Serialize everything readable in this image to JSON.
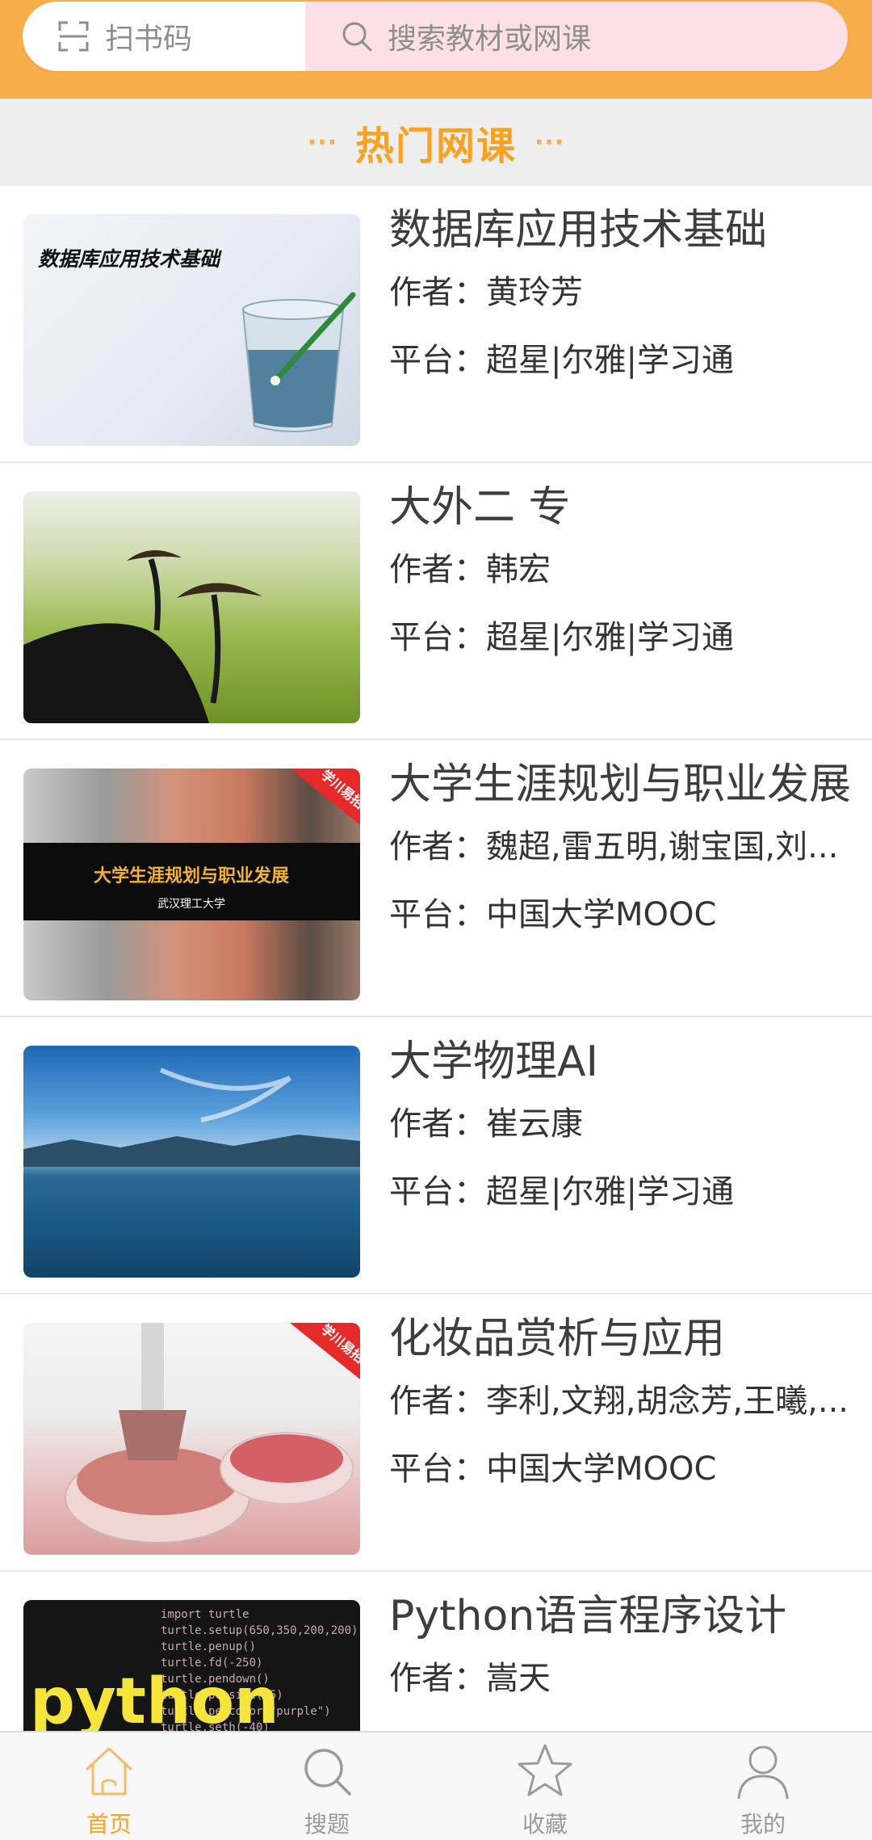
{
  "search_bar": {
    "scan_label": "扫书码",
    "search_placeholder": "搜索教材或网课"
  },
  "section": {
    "title": "热门网课",
    "dots_left": "···",
    "dots_right": "···"
  },
  "courses": [
    {
      "title": "数据库应用技术基础",
      "author_line": "作者：黄玲芳",
      "platform_line": "平台：超星|尔雅|学习通",
      "cover_text": "数据库应用技术基础"
    },
    {
      "title": "大外二 专",
      "author_line": "作者：韩宏",
      "platform_line": "平台：超星|尔雅|学习通"
    },
    {
      "title": "大学生涯规划与职业发展",
      "author_line": "作者：魏超,雷五明,谢宝国,刘...",
      "platform_line": "平台：中国大学MOOC",
      "cover_text": "大学生涯规划与职业发展",
      "cover_subtext": "武汉理工大学",
      "cover_badge": "学川易招"
    },
    {
      "title": "大学物理AI",
      "author_line": "作者：崔云康",
      "platform_line": "平台：超星|尔雅|学习通"
    },
    {
      "title": "化妆品赏析与应用",
      "author_line": "作者：李利,文翔,胡念芳,王曦,...",
      "platform_line": "平台：中国大学MOOC",
      "cover_badge": "学川易招"
    },
    {
      "title": "Python语言程序设计",
      "author_line": "作者：嵩天",
      "platform_line": "",
      "cover_text": "python",
      "cover_code": [
        "import turtle",
        "turtle.setup(650,350,200,200)",
        "turtle.penup()",
        "turtle.fd(-250)",
        "turtle.pendown()",
        "turtle.pensize(25)",
        "turtle.pencolor(\"purple\")",
        "turtle.seth(-40)"
      ]
    }
  ],
  "bottom_nav": [
    {
      "label": "首页",
      "icon": "home-icon",
      "active": true
    },
    {
      "label": "搜题",
      "icon": "search-icon",
      "active": false
    },
    {
      "label": "收藏",
      "icon": "star-icon",
      "active": false
    },
    {
      "label": "我的",
      "icon": "user-icon",
      "active": false
    }
  ],
  "colors": {
    "accent": "#f9ad4a",
    "accent_text": "#f7a223",
    "search_bg": "#fde0e7",
    "section_bg": "#eeeeee"
  }
}
